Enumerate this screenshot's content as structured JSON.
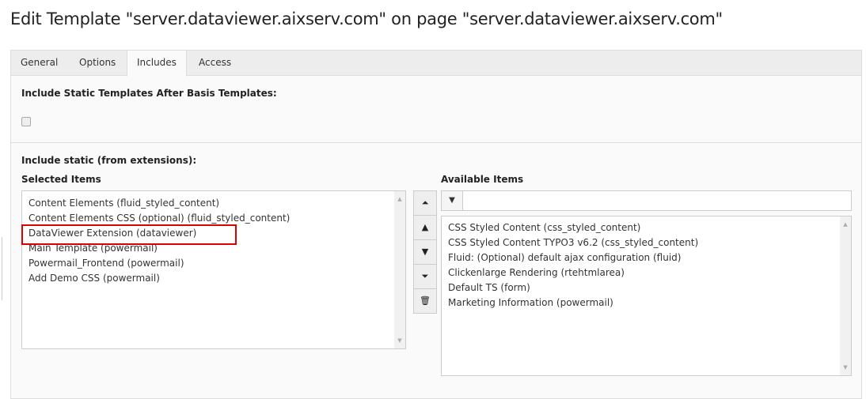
{
  "title": "Edit Template \"server.dataviewer.aixserv.com\" on page \"server.dataviewer.aixserv.com\"",
  "tabs": [
    {
      "label": "General"
    },
    {
      "label": "Options"
    },
    {
      "label": "Includes",
      "active": true
    },
    {
      "label": "Access"
    }
  ],
  "include_after_basis": {
    "label": "Include Static Templates After Basis Templates:",
    "checked": false
  },
  "include_static": {
    "label": "Include static (from extensions):",
    "selected_label": "Selected Items",
    "available_label": "Available Items",
    "selected": [
      "Content Elements (fluid_styled_content)",
      "Content Elements CSS (optional) (fluid_styled_content)",
      "DataViewer Extension (dataviewer)",
      "Main Template (powermail)",
      "Powermail_Frontend (powermail)",
      "Add Demo CSS (powermail)"
    ],
    "available": [
      "CSS Styled Content (css_styled_content)",
      "CSS Styled Content TYPO3 v6.2 (css_styled_content)",
      "Fluid: (Optional) default ajax configuration (fluid)",
      "Clickenlarge Rendering (rtehtmlarea)",
      "Default TS (form)",
      "Marketing Information (powermail)"
    ],
    "filter_value": "",
    "highlight_color": "#dd0000"
  },
  "buttons": [
    {
      "icon": "move-to-top-icon",
      "glyph": "⏶"
    },
    {
      "icon": "move-up-icon",
      "glyph": "▲"
    },
    {
      "icon": "move-down-icon",
      "glyph": "▼"
    },
    {
      "icon": "move-to-bottom-icon",
      "glyph": "⏷"
    },
    {
      "icon": "trash-icon",
      "glyph": "🗑"
    }
  ]
}
